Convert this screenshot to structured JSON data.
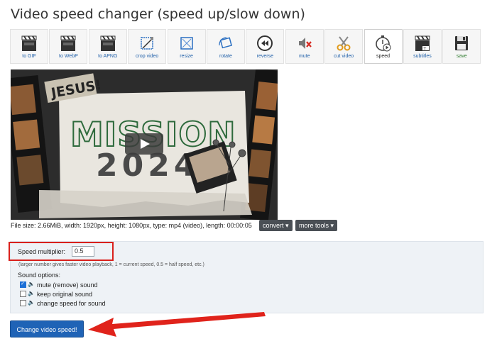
{
  "page_title": "Video speed changer (speed up/slow down)",
  "toolbar": {
    "items": [
      {
        "label": "to GIF",
        "icon": "film-clapper-icon"
      },
      {
        "label": "to WebP",
        "icon": "film-clapper-icon"
      },
      {
        "label": "to APNG",
        "icon": "film-clapper-icon"
      },
      {
        "label": "crop video",
        "icon": "crop-icon"
      },
      {
        "label": "resize",
        "icon": "resize-icon"
      },
      {
        "label": "rotate",
        "icon": "rotate-icon"
      },
      {
        "label": "reverse",
        "icon": "rewind-icon"
      },
      {
        "label": "mute",
        "icon": "mute-speaker-icon"
      },
      {
        "label": "cut video",
        "icon": "scissors-icon"
      },
      {
        "label": "speed",
        "icon": "stopwatch-icon"
      },
      {
        "label": "subtitles",
        "icon": "subtitles-clapper-icon"
      },
      {
        "label": "save",
        "icon": "floppy-disk-icon"
      }
    ],
    "active": "speed"
  },
  "video": {
    "headline": "MISSION",
    "year": "2024",
    "tag": "JESUS!"
  },
  "file_info": "File size: 2.66MiB, width: 1920px, height: 1080px, type: mp4 (video), length: 00:00:05",
  "buttons": {
    "convert": "convert ▾",
    "more_tools": "more tools ▾",
    "submit": "Change video speed!"
  },
  "form": {
    "speed_label": "Speed multiplier:",
    "speed_value": "0.5",
    "speed_hint": "(larger number gives faster video playback, 1 = current speed, 0.5 = half speed, etc.)",
    "sound_options_label": "Sound options:",
    "sound_options": [
      {
        "label": "mute (remove) sound",
        "checked": true
      },
      {
        "label": "keep original sound",
        "checked": false
      },
      {
        "label": "change speed for sound",
        "checked": false
      }
    ]
  },
  "colors": {
    "highlight_red": "#d9201c",
    "primary_blue": "#1f63b6"
  }
}
